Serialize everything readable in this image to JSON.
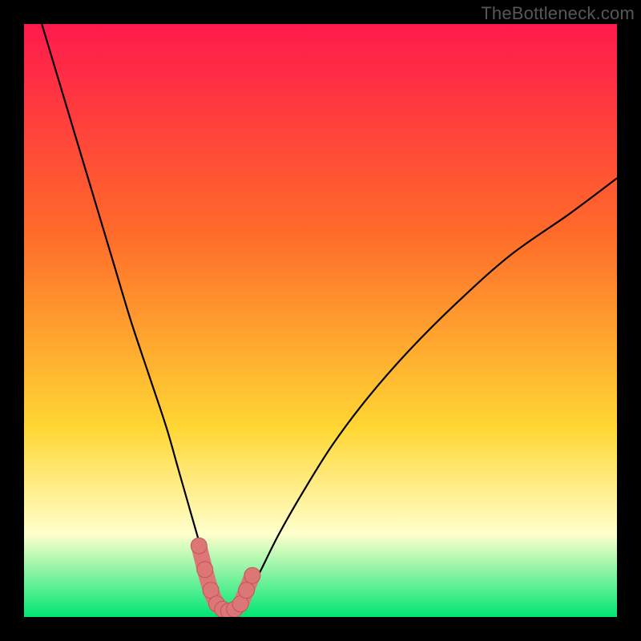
{
  "watermark": "TheBottleneck.com",
  "colors": {
    "gradient_top": "#ff1a4d",
    "gradient_mid1": "#ff6a2a",
    "gradient_mid2": "#ffd633",
    "gradient_pale": "#ffffcc",
    "gradient_green": "#00e673",
    "curve": "#000000",
    "marker_fill": "#dd7777",
    "marker_stroke": "#c05555"
  },
  "chart_data": {
    "type": "line",
    "title": "",
    "xlabel": "",
    "ylabel": "",
    "xlim": [
      0,
      100
    ],
    "ylim": [
      0,
      100
    ],
    "series": [
      {
        "name": "bottleneck-curve",
        "x": [
          3,
          6,
          9,
          12,
          15,
          18,
          21,
          24,
          26,
          28,
          30,
          31,
          32,
          33,
          34,
          35,
          36,
          37,
          38,
          40,
          43,
          47,
          52,
          58,
          65,
          73,
          82,
          92,
          100
        ],
        "y": [
          100,
          90,
          80,
          70,
          60,
          50,
          41,
          32,
          25,
          18,
          11,
          7,
          4,
          2,
          1.2,
          1,
          1.2,
          2,
          4,
          8,
          14,
          21,
          29,
          37,
          45,
          53,
          61,
          68,
          74
        ]
      }
    ],
    "markers": {
      "name": "highlight-region",
      "x": [
        29.5,
        30.5,
        31.5,
        32.5,
        33.5,
        34.5,
        35.5,
        36.5,
        37.5,
        38.5
      ],
      "y": [
        12,
        8,
        4.5,
        2.2,
        1.3,
        1.0,
        1.3,
        2.2,
        4.5,
        7
      ]
    }
  }
}
